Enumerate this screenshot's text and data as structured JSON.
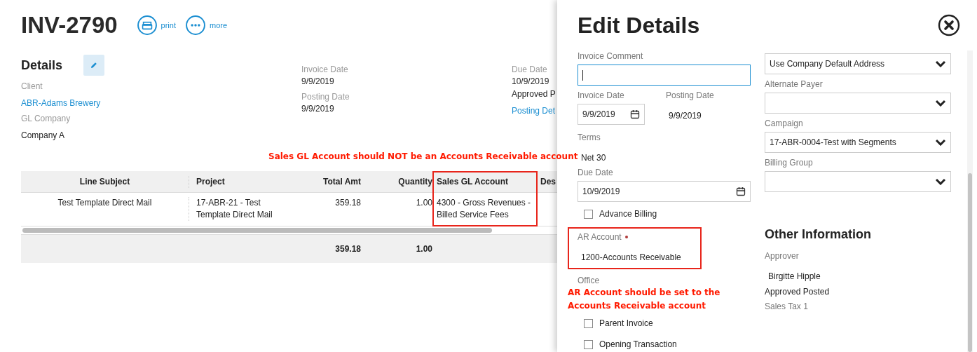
{
  "header": {
    "title": "INV-2790",
    "actions": [
      {
        "label": "print"
      },
      {
        "label": "more"
      }
    ]
  },
  "details": {
    "heading": "Details",
    "columns": [
      [
        {
          "kind": "label",
          "text": "Client"
        },
        {
          "kind": "link",
          "text": "ABR-Adams Brewery"
        },
        {
          "kind": "label",
          "text": "GL Company"
        },
        {
          "kind": "value",
          "text": "Company A"
        }
      ],
      [
        {
          "kind": "label",
          "text": "Invoice Date"
        },
        {
          "kind": "value",
          "text": "9/9/2019"
        },
        {
          "kind": "label",
          "text": "Posting Date"
        },
        {
          "kind": "value",
          "text": "9/9/2019"
        }
      ],
      [
        {
          "kind": "label",
          "text": "Due Date"
        },
        {
          "kind": "value",
          "text": "10/9/2019"
        },
        {
          "kind": "value",
          "text": "Approved P"
        },
        {
          "kind": "link",
          "text": "Posting Det"
        }
      ]
    ]
  },
  "annotations": [
    "Sales GL Account should NOT be an Accounts Receivable account"
  ],
  "table": {
    "columns": [
      {
        "label": "Line Subject",
        "highlighted": false
      },
      {
        "label": "Project",
        "highlighted": false
      },
      {
        "label": "Total Amt",
        "highlighted": false
      },
      {
        "label": "Quantity",
        "highlighted": false
      },
      {
        "label": "Sales GL Account",
        "highlighted": true
      },
      {
        "label": "Des",
        "highlighted": false
      }
    ],
    "rows": [
      [
        "Test Template Direct Mail",
        "17-ABR-21 - Test Template Direct Mail",
        "359.18",
        "1.00",
        "4300 - Gross Revenues - Billed Service Fees"
      ]
    ],
    "totals": {
      "total_amt": "359.18",
      "quantity": "1.00"
    }
  },
  "edit_panel": {
    "title": "Edit Details",
    "left": [
      {
        "kind": "input",
        "label": "Invoice Comment",
        "focused": true
      },
      {
        "kind": "date-row",
        "label": "Invoice Date",
        "value": "9/9/2019",
        "side_label": "Posting Date",
        "side_value": "9/9/2019"
      },
      {
        "kind": "static",
        "label": "Terms",
        "value": "Net 30"
      },
      {
        "kind": "date",
        "label": "Due Date",
        "value": "10/9/2019"
      },
      {
        "kind": "checkbox",
        "label": "Advance Billing",
        "checked": false
      },
      {
        "kind": "static",
        "label": "AR Account",
        "value": "1200-Accounts Receivable",
        "required": true,
        "highlighted": true
      },
      {
        "kind": "label",
        "label": "Office"
      },
      {
        "kind": "note",
        "label": "AR Account should be set to the Accounts Receivable account"
      },
      {
        "kind": "checkbox",
        "label": "Parent Invoice",
        "checked": false
      },
      {
        "kind": "checkbox",
        "label": "Opening Transaction",
        "checked": false
      }
    ],
    "right": [
      {
        "kind": "select",
        "value": "Use Company Default Address"
      },
      {
        "kind": "select",
        "label": "Alternate Payer"
      },
      {
        "kind": "select",
        "label": "Campaign",
        "value": "17-ABR-0004-Test with Segments"
      },
      {
        "kind": "select",
        "label": "Billing Group"
      },
      {
        "kind": "heading",
        "label": "Other Information"
      },
      {
        "kind": "static",
        "label": "Approver",
        "value": "Birgitte Hipple"
      },
      {
        "kind": "text",
        "label": "Approved Posted"
      },
      {
        "kind": "label",
        "label": "Sales Tax 1"
      }
    ]
  }
}
